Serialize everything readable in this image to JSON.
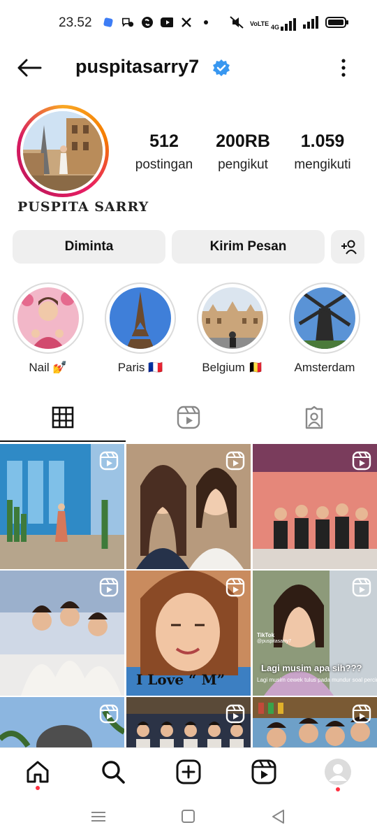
{
  "status_bar": {
    "time": "23.52",
    "notification_icons": [
      "app-icon",
      "messenger-icon",
      "shazam-icon",
      "youtube-icon",
      "x-icon",
      "dot-icon"
    ],
    "system_labels": {
      "volte": "VoLTE",
      "network": "4G"
    }
  },
  "header": {
    "username": "puspitasarry7",
    "verified": true
  },
  "profile": {
    "display_name": "PUSPITA SARRY",
    "stats": [
      {
        "value": "512",
        "label": "postingan"
      },
      {
        "value": "200RB",
        "label": "pengikut"
      },
      {
        "value": "1.059",
        "label": "mengikuti"
      }
    ]
  },
  "actions": {
    "requested_label": "Diminta",
    "message_label": "Kirim Pesan"
  },
  "highlights": [
    {
      "label": "Nail 💅"
    },
    {
      "label": "Paris 🇫🇷"
    },
    {
      "label": "Belgium 🇧🇪"
    },
    {
      "label": "Amsterdam"
    }
  ],
  "tabs": [
    "grid-icon",
    "reels-icon",
    "tagged-icon"
  ],
  "grid": {
    "overlay_1": "I Love “ M”",
    "overlay_2": "Lagi musim apa sih???",
    "overlay_3": "Lagi musim cewek tulus pada mundur soal percintaan",
    "tiktok_tag": "TikTok",
    "tiktok_handle": "@puspitasarry7"
  },
  "colors": {
    "accent_verified": "#3897f0",
    "notification_dot": "#ff3040",
    "button_bg": "#efefef"
  }
}
